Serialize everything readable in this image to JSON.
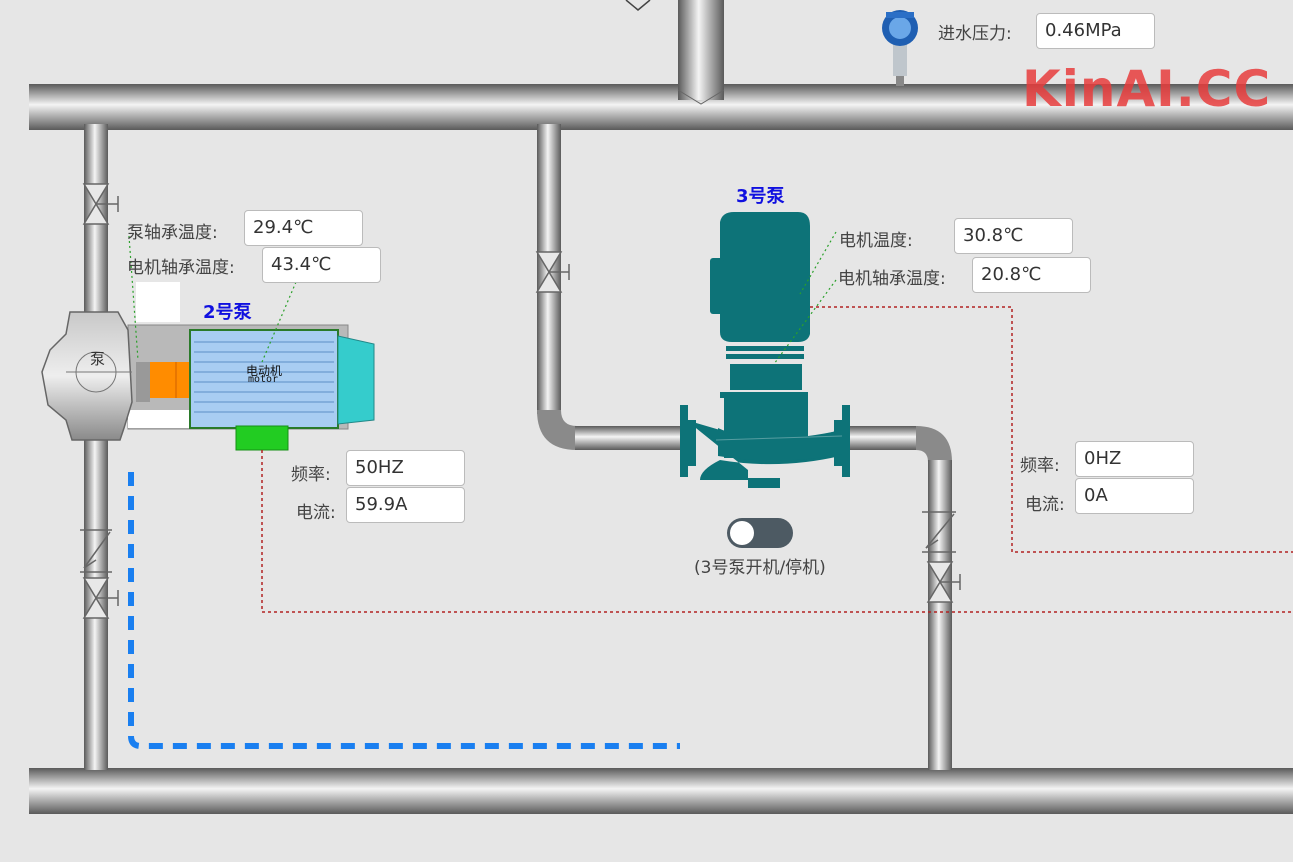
{
  "watermark": "KinAI.CC",
  "inlet": {
    "label": "进水压力:",
    "value": "0.46MPa"
  },
  "pump2": {
    "title": "2号泵",
    "bearing_temp_label": "泵轴承温度:",
    "bearing_temp_value": "29.4℃",
    "motor_bearing_temp_label": "电机轴承温度:",
    "motor_bearing_temp_value": "43.4℃",
    "freq_label": "频率:",
    "freq_value": "50HZ",
    "current_label": "电流:",
    "current_value": "59.9A",
    "pump_text": "泵",
    "motor_text_cn": "电动机",
    "motor_text_en": "motor"
  },
  "pump3": {
    "title": "3号泵",
    "motor_temp_label": "电机温度:",
    "motor_temp_value": "30.8℃",
    "motor_bearing_temp_label": "电机轴承温度:",
    "motor_bearing_temp_value": "20.8℃",
    "freq_label": "频率:",
    "freq_value": "0HZ",
    "current_label": "电流:",
    "current_value": "0A",
    "toggle_caption": "(3号泵开机/停机)",
    "running": false
  },
  "colors": {
    "pipe": "#9a9a9a",
    "pump3_body": "#0d7378",
    "motor_blue": "#a8cdf2",
    "motor_cap": "#35cccc",
    "accent_blue": "#1a7ff0",
    "signal_red": "#b22222",
    "title_blue": "#1010e0"
  },
  "icons": {
    "valve": "gate-valve-icon",
    "check_valve": "check-valve-icon",
    "pressure_sensor": "pressure-transmitter-icon"
  }
}
